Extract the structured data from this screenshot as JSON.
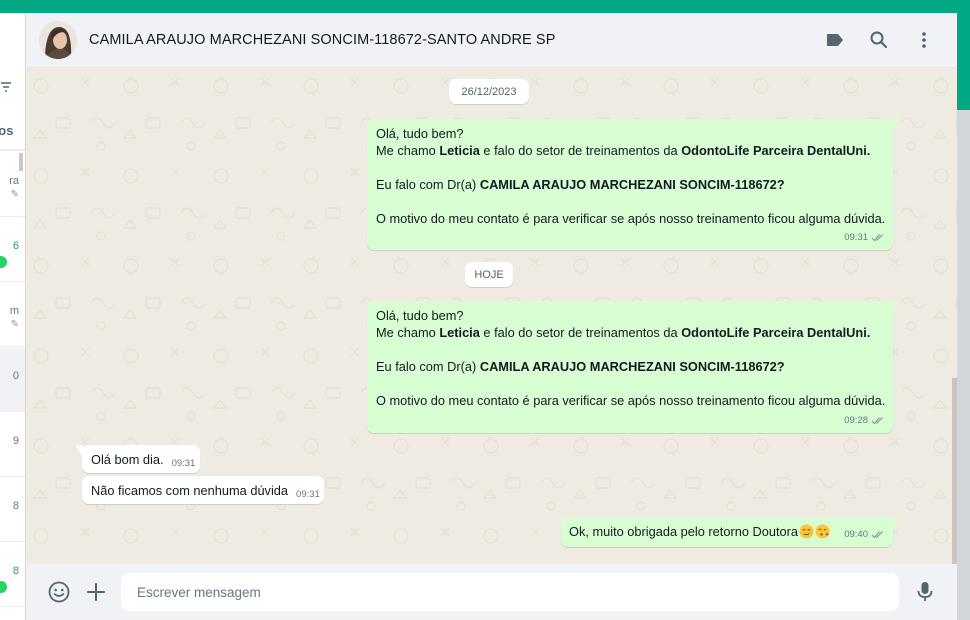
{
  "colors": {
    "brand": "#00a884",
    "outgoing_bubble": "#d9fdd3",
    "incoming_bubble": "#ffffff",
    "chat_background": "#efeae2",
    "header_background": "#f0f2f5",
    "tick_color": "#8696a0"
  },
  "sidebar": {
    "tab_label": "ntos",
    "items": [
      {
        "meta": "ra",
        "pinned": true
      },
      {
        "meta": "6",
        "unread": true
      },
      {
        "meta": "m",
        "pinned": true
      },
      {
        "meta": "0",
        "active": true
      },
      {
        "meta": "9"
      },
      {
        "meta": "8"
      },
      {
        "meta": "8",
        "unread": true
      }
    ]
  },
  "header": {
    "contact_name": "CAMILA ARAUJO MARCHEZANI SONCIM-118672-SANTO ANDRE SP",
    "icons": [
      "label-icon",
      "search-icon",
      "menu-icon"
    ]
  },
  "chat": {
    "date_1": "26/12/2023",
    "date_2": "HOJE",
    "message_1": {
      "greeting": "Olá, tudo bem?",
      "intro_prefix": "Me chamo ",
      "intro_name": "Leticia",
      "intro_middle": " e falo do setor de treinamentos  da ",
      "intro_company": "OdontoLife Parceira DentalUni.",
      "question_prefix": " Eu falo com Dr(a) ",
      "question_name": "CAMILA ARAUJO MARCHEZANI SONCIM-118672?",
      "reason": "O motivo do meu contato é para verificar se após nosso treinamento ficou alguma dúvida.",
      "time": "09:31",
      "status": "delivered"
    },
    "message_2": {
      "greeting": "Olá, tudo bem?",
      "intro_prefix": "Me chamo ",
      "intro_name": "Leticia",
      "intro_middle": " e falo do setor de treinamentos  da ",
      "intro_company": "OdontoLife Parceira DentalUni.",
      "question_prefix": " Eu falo com Dr(a) ",
      "question_name": "CAMILA ARAUJO MARCHEZANI SONCIM-118672?",
      "reason": "O motivo do meu contato é para verificar se após nosso treinamento ficou alguma dúvida.",
      "time": "09:28",
      "status": "delivered"
    },
    "incoming_1": {
      "text": "Olá bom dia.",
      "time": "09:31"
    },
    "incoming_2": {
      "text": "Não ficamos com nenhuma dúvida",
      "time": "09:31"
    },
    "reply": {
      "text": "Ok, muito obrigada pelo retorno Doutora",
      "emojis": [
        "smirking-face",
        "face-blowing-kiss"
      ],
      "time": "09:40",
      "status": "delivered"
    }
  },
  "footer": {
    "placeholder": "Escrever mensagem",
    "icons": [
      "emoji-icon",
      "attach-plus-icon",
      "microphone-icon"
    ]
  }
}
